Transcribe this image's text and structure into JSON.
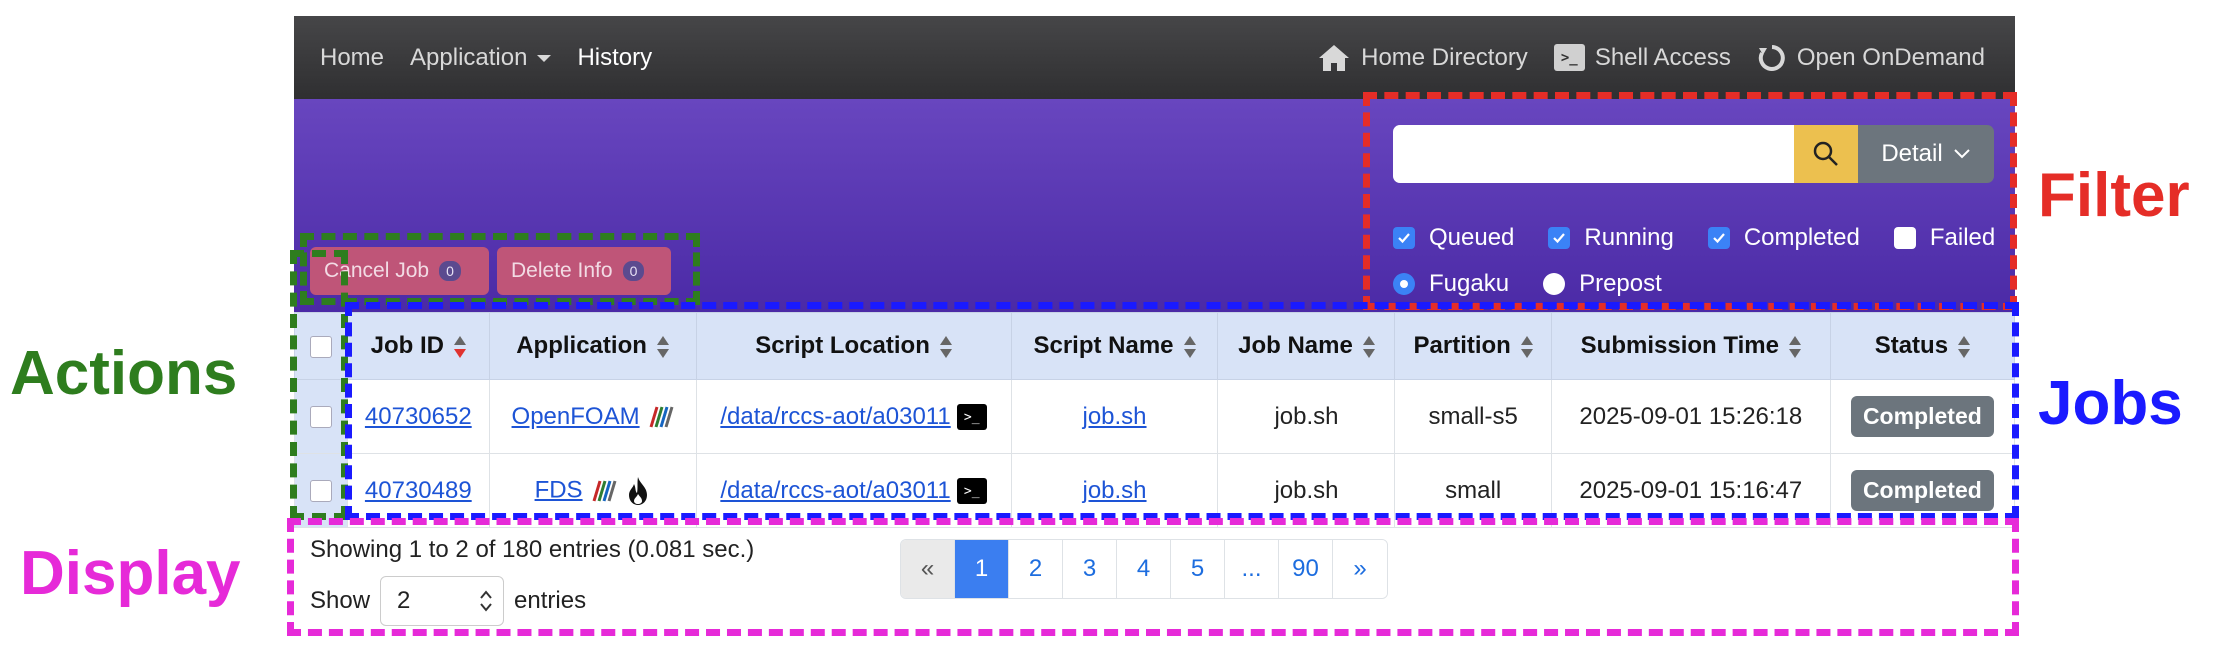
{
  "navbar": {
    "home": "Home",
    "application": "Application",
    "history": "History",
    "home_directory": "Home Directory",
    "shell_access": "Shell Access",
    "open_ondemand": "Open OnDemand"
  },
  "actions": {
    "cancel_job": "Cancel Job",
    "cancel_count": "0",
    "delete_info": "Delete Info",
    "delete_count": "0"
  },
  "filter": {
    "search_value": "",
    "detail_label": "Detail",
    "checkboxes": [
      {
        "label": "Queued",
        "checked": true
      },
      {
        "label": "Running",
        "checked": true
      },
      {
        "label": "Completed",
        "checked": true
      },
      {
        "label": "Failed",
        "checked": false
      }
    ],
    "radios": [
      {
        "label": "Fugaku",
        "selected": true
      },
      {
        "label": "Prepost",
        "selected": false
      }
    ]
  },
  "table": {
    "headers": [
      "Job ID",
      "Application",
      "Script Location",
      "Script Name",
      "Job Name",
      "Partition",
      "Submission Time",
      "Status"
    ],
    "rows": [
      {
        "job_id": "40730652",
        "application": "OpenFOAM",
        "script_location": "/data/rccs-aot/a03011",
        "script_name": "job.sh",
        "job_name": "job.sh",
        "partition": "small-s5",
        "submission_time": "2025-09-01 15:26:18",
        "status": "Completed"
      },
      {
        "job_id": "40730489",
        "application": "FDS",
        "script_location": "/data/rccs-aot/a03011",
        "script_name": "job.sh",
        "job_name": "job.sh",
        "partition": "small",
        "submission_time": "2025-09-01 15:16:47",
        "status": "Completed"
      }
    ]
  },
  "display": {
    "showing": "Showing 1 to 2 of 180 entries (0.081 sec.)",
    "show_label": "Show",
    "show_value": "2",
    "entries_label": "entries",
    "pages": [
      "«",
      "1",
      "2",
      "3",
      "4",
      "5",
      "...",
      "90",
      "»"
    ],
    "active_page": "1"
  },
  "annotations": {
    "actions": {
      "label": "Actions",
      "color": "#2e7d1e"
    },
    "filter": {
      "label": "Filter",
      "color": "#e52d27"
    },
    "jobs": {
      "label": "Jobs",
      "color": "#1a1aff"
    },
    "display": {
      "label": "Display",
      "color": "#e62ad8"
    }
  }
}
